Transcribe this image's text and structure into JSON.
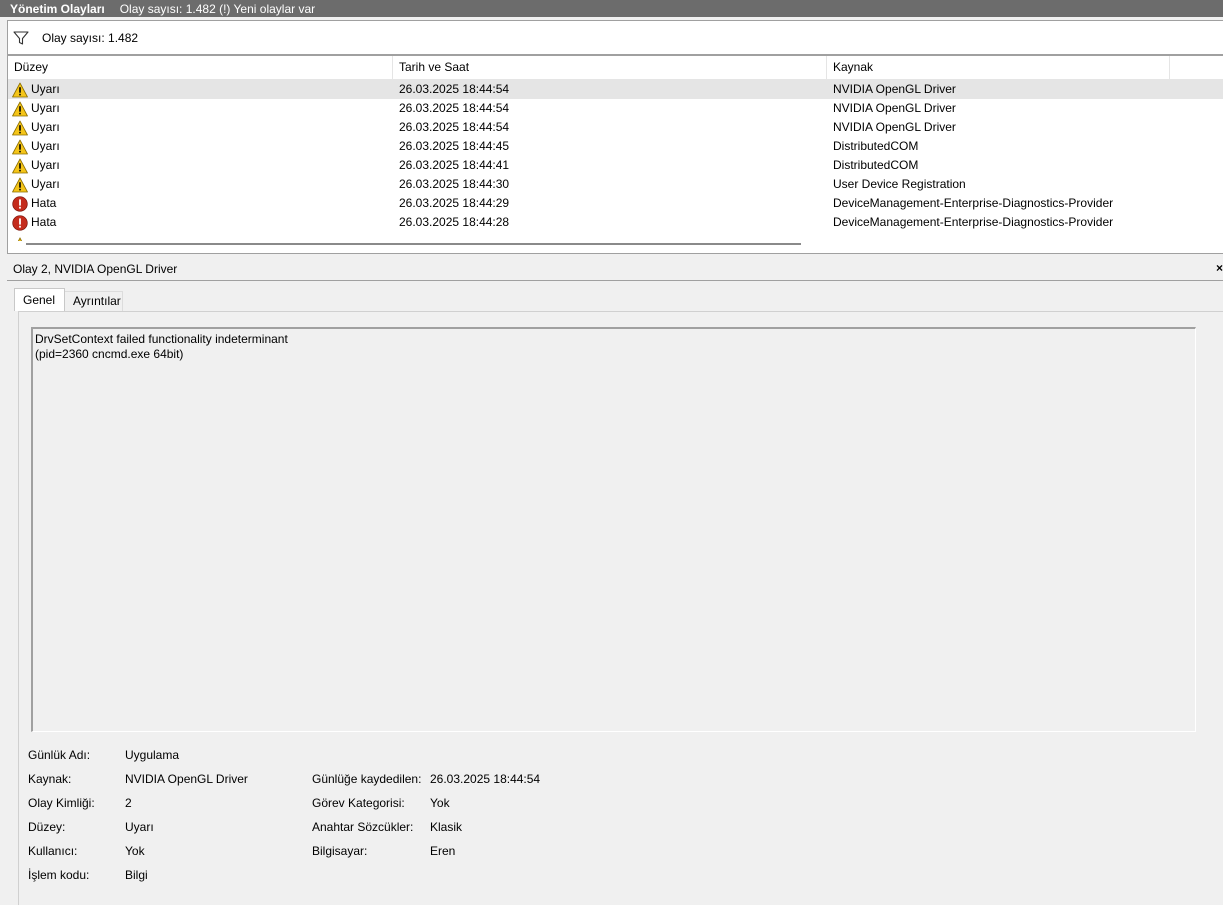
{
  "titlebar": {
    "title": "Yönetim Olayları",
    "subtitle": "Olay sayısı: 1.482 (!) Yeni olaylar var"
  },
  "filter": {
    "icon": "filter-icon",
    "count_text": "Olay sayısı: 1.482"
  },
  "list": {
    "columns": [
      "Düzey",
      "Tarih ve Saat",
      "Kaynak"
    ],
    "rows": [
      {
        "level": "Uyarı",
        "icon": "warning-icon",
        "datetime": "26.03.2025 18:44:54",
        "source": "NVIDIA OpenGL Driver"
      },
      {
        "level": "Uyarı",
        "icon": "warning-icon",
        "datetime": "26.03.2025 18:44:54",
        "source": "NVIDIA OpenGL Driver"
      },
      {
        "level": "Uyarı",
        "icon": "warning-icon",
        "datetime": "26.03.2025 18:44:54",
        "source": "NVIDIA OpenGL Driver"
      },
      {
        "level": "Uyarı",
        "icon": "warning-icon",
        "datetime": "26.03.2025 18:44:45",
        "source": "DistributedCOM"
      },
      {
        "level": "Uyarı",
        "icon": "warning-icon",
        "datetime": "26.03.2025 18:44:41",
        "source": "DistributedCOM"
      },
      {
        "level": "Uyarı",
        "icon": "warning-icon",
        "datetime": "26.03.2025 18:44:30",
        "source": "User Device Registration"
      },
      {
        "level": "Hata",
        "icon": "error-icon",
        "datetime": "26.03.2025 18:44:29",
        "source": "DeviceManagement-Enterprise-Diagnostics-Provider"
      },
      {
        "level": "Hata",
        "icon": "error-icon",
        "datetime": "26.03.2025 18:44:28",
        "source": "DeviceManagement-Enterprise-Diagnostics-Provider"
      }
    ]
  },
  "detail": {
    "title": "Olay 2, NVIDIA OpenGL Driver",
    "close_label": "×",
    "tabs": [
      "Genel",
      "Ayrıntılar"
    ],
    "description_line1": "DrvSetContext failed functionality indeterminant",
    "description_line2": "(pid=2360 cncmd.exe 64bit)",
    "props": {
      "log_name_label": "Günlük Adı:",
      "log_name": "Uygulama",
      "source_label": "Kaynak:",
      "source": "NVIDIA OpenGL Driver",
      "logged_label": "Günlüğe kaydedilen:",
      "logged": "26.03.2025 18:44:54",
      "event_id_label": "Olay Kimliği:",
      "event_id": "2",
      "task_label": "Görev Kategorisi:",
      "task": "Yok",
      "level_label": "Düzey:",
      "level": "Uyarı",
      "keywords_label": "Anahtar Sözcükler:",
      "keywords": "Klasik",
      "user_label": "Kullanıcı:",
      "user": "Yok",
      "computer_label": "Bilgisayar:",
      "computer": "Eren",
      "opcode_label": "İşlem kodu:",
      "opcode": "Bilgi"
    }
  }
}
